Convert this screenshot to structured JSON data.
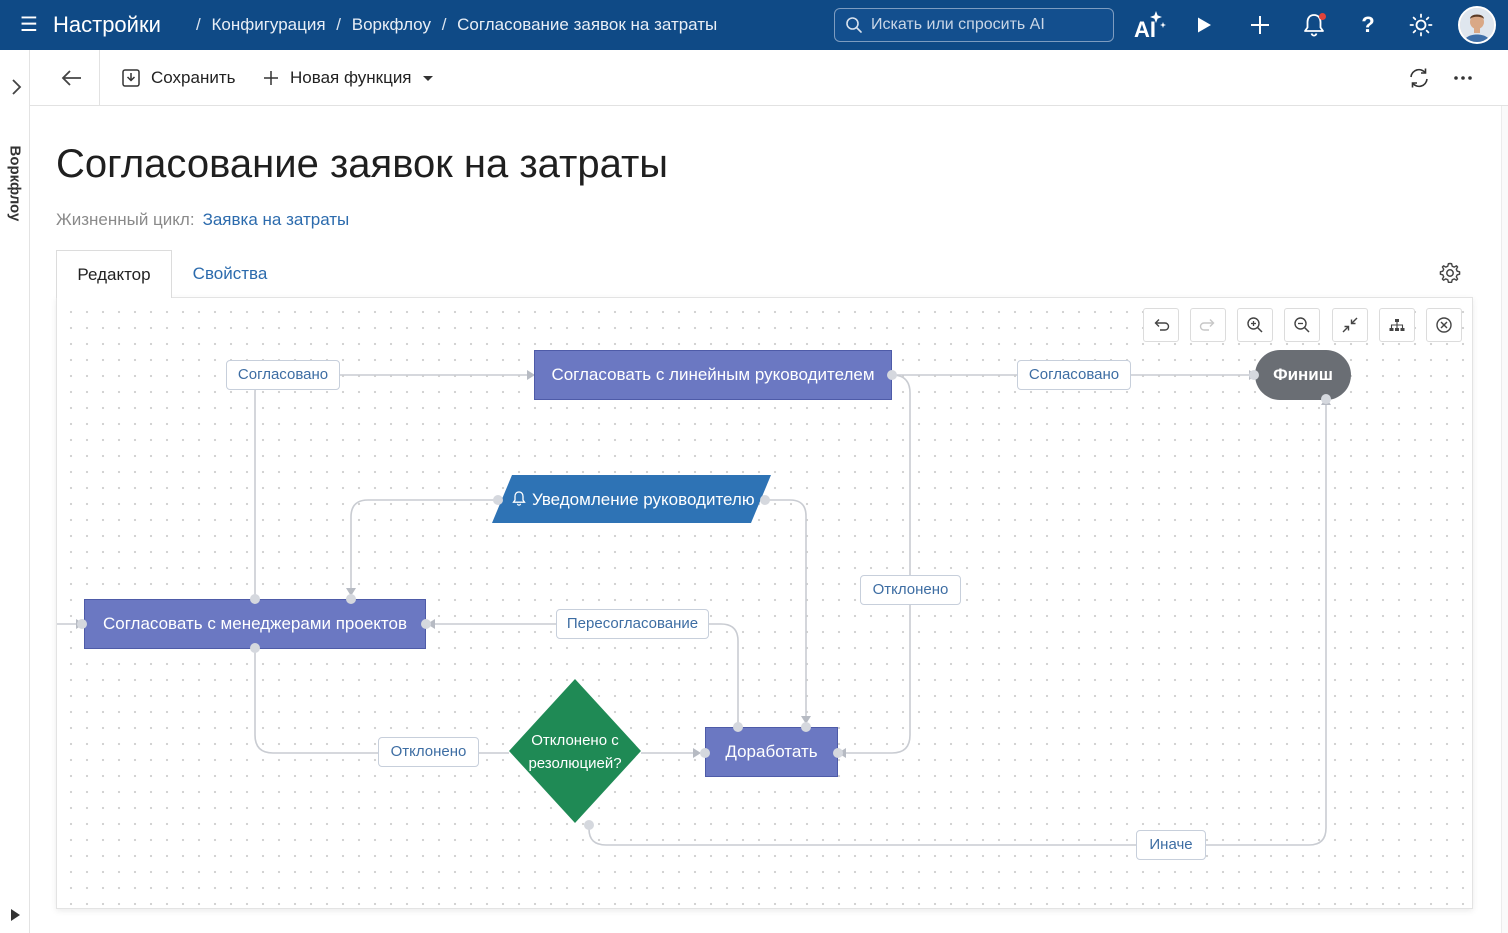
{
  "topbar": {
    "app_title": "Настройки",
    "breadcrumbs": [
      "Конфигурация",
      "Воркфлоу",
      "Согласование заявок на затраты"
    ],
    "search_placeholder": "Искать или спросить AI",
    "icons": [
      "menu-icon",
      "search-icon",
      "ai-sparkle-icon",
      "play-icon",
      "plus-icon",
      "bell-icon",
      "help-icon",
      "sun-icon",
      "avatar"
    ],
    "ai_label": "AI",
    "help_label": "?"
  },
  "siderail": {
    "label": "Воркфлоу"
  },
  "toolbar": {
    "save_label": "Сохранить",
    "new_function_label": "Новая функция"
  },
  "page": {
    "title": "Согласование заявок на затраты",
    "lifecycle_label": "Жизненный цикл:",
    "lifecycle_value": "Заявка на затраты"
  },
  "tabs": [
    {
      "label": "Редактор",
      "active": true
    },
    {
      "label": "Свойства",
      "active": false
    }
  ],
  "diagram": {
    "nodes": {
      "approve_line_manager": "Согласовать с линейным руководителем",
      "finish": "Финиш",
      "notify_manager": "Уведомление руководителю",
      "approve_project_managers": "Согласовать с менеджерами проектов",
      "decision": [
        "Отклонено с",
        "резолюцией?"
      ],
      "rework": "Доработать"
    },
    "edge_labels": {
      "approved_left": "Согласовано",
      "approved_right": "Согласовано",
      "rejected_right": "Отклонено",
      "reapproval": "Пересогласование",
      "rejected_bottom": "Отклонено",
      "otherwise": "Иначе"
    },
    "colors": {
      "task": "#6b78c2",
      "notification": "#2e73b5",
      "decision": "#1f8a55",
      "finish": "#6a6e74",
      "wire": "#c9ccd2"
    }
  }
}
